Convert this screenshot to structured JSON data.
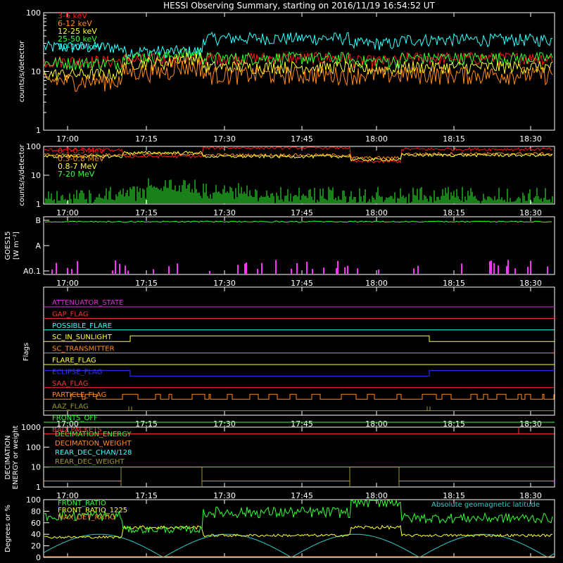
{
  "title": "HESSI Observing Summary, starting on 2016/11/19 16:54:52 UT",
  "time_ticks": [
    "17:00",
    "17:15",
    "17:30",
    "17:45",
    "18:00",
    "18:15",
    "18:30"
  ],
  "chart_data": [
    {
      "type": "line",
      "id": "hxr",
      "ylabel": "counts/s/detector",
      "yscale": "log",
      "ylim": [
        1,
        100
      ],
      "yticks": [
        "1",
        "10",
        "100"
      ],
      "series": [
        {
          "name": "3-6 keV",
          "color": "#ff1a1a",
          "segments": [
            [
              0,
              15
            ],
            [
              0.155,
              16
            ],
            [
              0.31,
              17
            ],
            [
              0.6,
              15
            ],
            [
              0.7,
              17
            ],
            [
              1,
              16
            ]
          ]
        },
        {
          "name": "6-12 keV",
          "color": "#ff8c1a",
          "segments": [
            [
              0,
              7
            ],
            [
              0.155,
              10
            ],
            [
              0.25,
              12
            ],
            [
              0.31,
              9
            ],
            [
              0.6,
              9
            ],
            [
              0.7,
              9
            ],
            [
              1,
              8
            ]
          ]
        },
        {
          "name": "12-25 keV",
          "color": "#ffff33",
          "segments": [
            [
              0,
              9
            ],
            [
              0.155,
              14
            ],
            [
              0.25,
              17
            ],
            [
              0.31,
              12
            ],
            [
              0.6,
              11
            ],
            [
              0.7,
              12
            ],
            [
              1,
              11
            ]
          ]
        },
        {
          "name": "25-50 keV",
          "color": "#33ff33",
          "segments": [
            [
              0,
              14
            ],
            [
              0.155,
              18
            ],
            [
              0.25,
              20
            ],
            [
              0.31,
              17
            ],
            [
              0.6,
              15
            ],
            [
              0.7,
              17
            ],
            [
              1,
              17
            ]
          ]
        },
        {
          "name": "50-100 keV",
          "color": "#33ffff",
          "segments": [
            [
              0,
              26
            ],
            [
              0.155,
              22
            ],
            [
              0.31,
              37
            ],
            [
              0.6,
              30
            ],
            [
              0.7,
              35
            ],
            [
              1,
              27
            ]
          ]
        }
      ]
    },
    {
      "type": "line",
      "id": "gamma",
      "ylabel": "counts/s/detector",
      "yscale": "log",
      "ylim": [
        1,
        100
      ],
      "yticks": [
        "1",
        "10",
        "100"
      ],
      "series": [
        {
          "name": "0.1-0.3 MeV",
          "color": "#ff1a1a",
          "segments": [
            [
              0,
              75
            ],
            [
              0.155,
              45
            ],
            [
              0.31,
              90
            ],
            [
              0.6,
              30
            ],
            [
              0.7,
              80
            ],
            [
              1,
              60
            ]
          ]
        },
        {
          "name": "0.3-0.8 MeV",
          "color": "#ff8c1a",
          "segments": [
            [
              0,
              50
            ],
            [
              0.155,
              55
            ],
            [
              0.31,
              50
            ],
            [
              0.6,
              40
            ],
            [
              0.7,
              55
            ],
            [
              1,
              45
            ]
          ]
        },
        {
          "name": "0.8-7 MeV",
          "color": "#ffff33",
          "segments": [
            [
              0,
              45
            ],
            [
              0.155,
              60
            ],
            [
              0.31,
              45
            ],
            [
              0.6,
              35
            ],
            [
              0.7,
              50
            ],
            [
              1,
              40
            ]
          ]
        },
        {
          "name": "7-20 MeV",
          "color": "#33ff33",
          "segments": [
            [
              0,
              1.5
            ],
            [
              0.1,
              2
            ],
            [
              0.2,
              4
            ],
            [
              0.3,
              2.5
            ],
            [
              0.4,
              1.8
            ],
            [
              1,
              1.8
            ]
          ]
        }
      ]
    },
    {
      "type": "line",
      "id": "goes",
      "ylabel": "GOES15",
      "ylabel2": "[W m⁻²]",
      "yticks": [
        "A0.1",
        "A",
        "B"
      ],
      "series": [
        {
          "name": "GOES flux",
          "color": "#33ff33",
          "level": 0.97
        }
      ]
    },
    {
      "type": "line",
      "id": "flags",
      "ylabel": "Flags",
      "flags": [
        {
          "name": "ATTENUATOR_STATE",
          "color": "#d633d6"
        },
        {
          "name": "GAP_FLAG",
          "color": "#ff3333"
        },
        {
          "name": "POSSIBLE_FLARE",
          "color": "#33ffff"
        },
        {
          "name": "SC_IN_SUNLIGHT",
          "color": "#ffff33"
        },
        {
          "name": "SC_TRANSMITTER",
          "color": "#ff8c1a"
        },
        {
          "name": "FLARE_FLAG",
          "color": "#ffff33"
        },
        {
          "name": "ECLIPSE_FLAG",
          "color": "#3333ff"
        },
        {
          "name": "SAA_FLAG",
          "color": "#ff3333"
        },
        {
          "name": "PARTICLE_FLAG",
          "color": "#ff8c1a"
        },
        {
          "name": "AAZ_FLAG",
          "color": "#999933"
        },
        {
          "name": "FRONTS_OFF",
          "color": "#33ff33"
        },
        {
          "name": "BAD_PACKETS",
          "color": "#ff3333"
        }
      ]
    },
    {
      "type": "line",
      "id": "decimation",
      "ylabel": "DECIMATION",
      "ylabel2": "ENERGY or weight",
      "yscale": "log",
      "ylim": [
        1,
        1000
      ],
      "yticks": [
        "1",
        "10",
        "100",
        "1000"
      ],
      "series": [
        {
          "name": "DECIMATION_ENERGY",
          "color": "#33ff33"
        },
        {
          "name": "DECIMATION_WEIGHT",
          "color": "#ff8c1a"
        },
        {
          "name": "REAR_DEC_CHAN/128",
          "color": "#33ffff"
        },
        {
          "name": "REAR_DEC_WEIGHT",
          "color": "#999933"
        }
      ]
    },
    {
      "type": "line",
      "id": "ratio",
      "ylabel": "Degrees or %",
      "ylim": [
        0,
        100
      ],
      "yticks": [
        "0",
        "20",
        "40",
        "60",
        "80",
        "100"
      ],
      "annotation": "Absolute geomagnetic latitude",
      "series": [
        {
          "name": "FRONT_RATIO",
          "color": "#33ff33",
          "segments": [
            [
              0,
              72
            ],
            [
              0.155,
              48
            ],
            [
              0.31,
              78
            ],
            [
              0.6,
              98
            ],
            [
              0.7,
              68
            ],
            [
              1,
              60
            ]
          ]
        },
        {
          "name": "FRONT_RATIO_1225",
          "color": "#ffff33",
          "segments": [
            [
              0,
              35
            ],
            [
              0.155,
              52
            ],
            [
              0.31,
              38
            ],
            [
              0.6,
              52
            ],
            [
              0.7,
              38
            ],
            [
              1,
              36
            ]
          ]
        },
        {
          "name": "MAX_DET_RATIO",
          "color": "#ff8c1a"
        }
      ]
    }
  ]
}
